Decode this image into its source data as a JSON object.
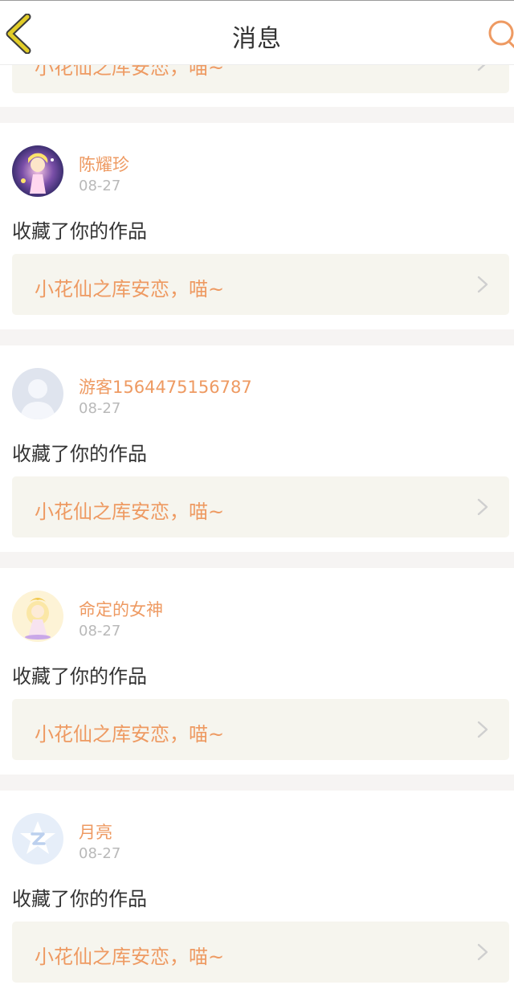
{
  "header": {
    "title": "消息",
    "back_icon": "chevron-left-icon",
    "search_icon": "search-icon",
    "accent_color": "#ee9a62",
    "back_color": "#d9c21a"
  },
  "messages": [
    {
      "username": "",
      "date": "",
      "action": "",
      "work_title": "小花仙之库安恋，喵~",
      "avatar": "none"
    },
    {
      "username": "陈耀珍",
      "date": "08-27",
      "action": "收藏了你的作品",
      "work_title": "小花仙之库安恋，喵~",
      "avatar": "anime-girl-avatar"
    },
    {
      "username": "游客1564475156787",
      "date": "08-27",
      "action": "收藏了你的作品",
      "work_title": "小花仙之库安恋，喵~",
      "avatar": "default-user-avatar"
    },
    {
      "username": "命定的女神",
      "date": "08-27",
      "action": "收藏了你的作品",
      "work_title": "小花仙之库安恋，喵~",
      "avatar": "fairy-avatar"
    },
    {
      "username": "月亮",
      "date": "08-27",
      "action": "收藏了你的作品",
      "work_title": "小花仙之库安恋，喵~",
      "avatar": "qzone-star-avatar"
    }
  ]
}
